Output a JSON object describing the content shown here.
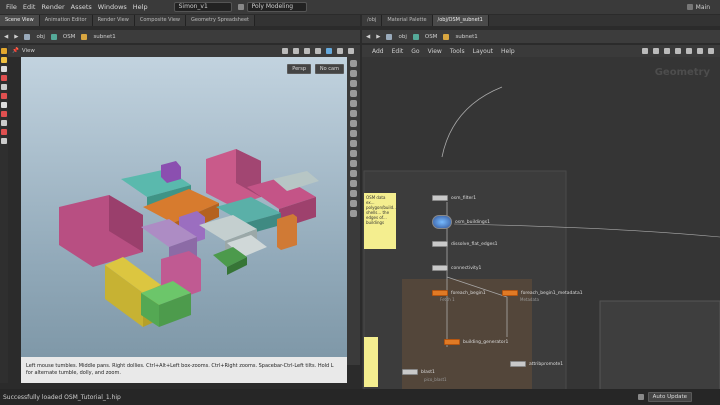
{
  "menubar": {
    "items": [
      "File",
      "Edit",
      "Render",
      "Assets",
      "Windows",
      "Help"
    ],
    "scene_field": "Simon_v1",
    "desktop_field": "Poly Modeling",
    "main_label": "Main"
  },
  "left_tabs": [
    "Scene View",
    "Animation Editor",
    "Render View",
    "Composite View",
    "Geometry Spreadsheet"
  ],
  "right_tabs": [
    "/obj",
    "Material Palette",
    "/obj/OSM_subnet1"
  ],
  "left_path": {
    "obj": "obj",
    "osm": "OSM",
    "subnet": "subnet1"
  },
  "right_path": {
    "obj": "obj",
    "osm": "OSM",
    "subnet": "subnet1"
  },
  "viewport": {
    "label": "View",
    "persp": "Persp",
    "cam": "No cam",
    "help_text": "Left mouse tumbles. Middle pans. Right dollies. Ctrl+Alt+Left box-zooms. Ctrl+Right zooms. Spacebar-Ctrl-Left tilts. Hold L for alternate tumble, dolly, and zoom."
  },
  "network": {
    "menu": [
      "Add",
      "Edit",
      "Go",
      "View",
      "Tools",
      "Layout",
      "Help"
    ],
    "watermark": "Geometry",
    "sticky_note": "OSM data ex... polygon/build... shells... the edges of... buildings",
    "nodes": [
      "osm_filter1",
      "osm_buildings1",
      "dissolve_flat_edges1",
      "connectivity1",
      "foreach_begin1",
      "foreach_begin1_metadata1",
      "building_generator1",
      "attribpromote1",
      "blast1"
    ],
    "sub_labels": {
      "foreach_begin1": "Fetch 1",
      "foreach_begin1_metadata1": "Metadata",
      "blast1": "pico_blast1"
    }
  },
  "status": {
    "message": "Successfully loaded OSM_Tutorial_1.hip",
    "auto_update": "Auto Update"
  },
  "colors": {
    "accent_orange": "#e07a25",
    "sticky_yellow": "#f4ee8f",
    "pink": "#c25586",
    "teal": "#4fb0a3",
    "green": "#55b35a"
  },
  "icons": [
    "file-icon",
    "hand-icon",
    "select-arrow-icon",
    "camera-icon",
    "gear-icon",
    "wrench-icon",
    "home-icon"
  ]
}
